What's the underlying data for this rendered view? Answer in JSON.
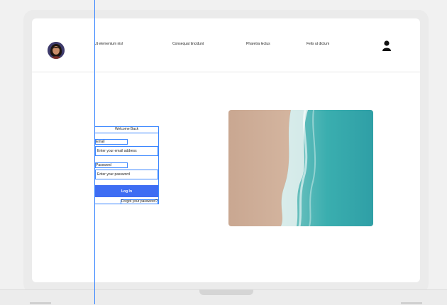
{
  "nav": {
    "links": [
      "Ut elementum nisl",
      "Consequat tincidunt",
      "Pharetra lectus",
      "Felis ut dictum"
    ]
  },
  "login": {
    "title": "Welcome Back",
    "email_label": "Email",
    "email_placeholder": "Enter your email address",
    "password_label": "Password",
    "password_placeholder": "Enter your password",
    "submit_label": "Log In",
    "forgot_label": "Forgot your password?"
  },
  "colors": {
    "accent": "#3e6df3",
    "guide": "#3a86ff"
  }
}
